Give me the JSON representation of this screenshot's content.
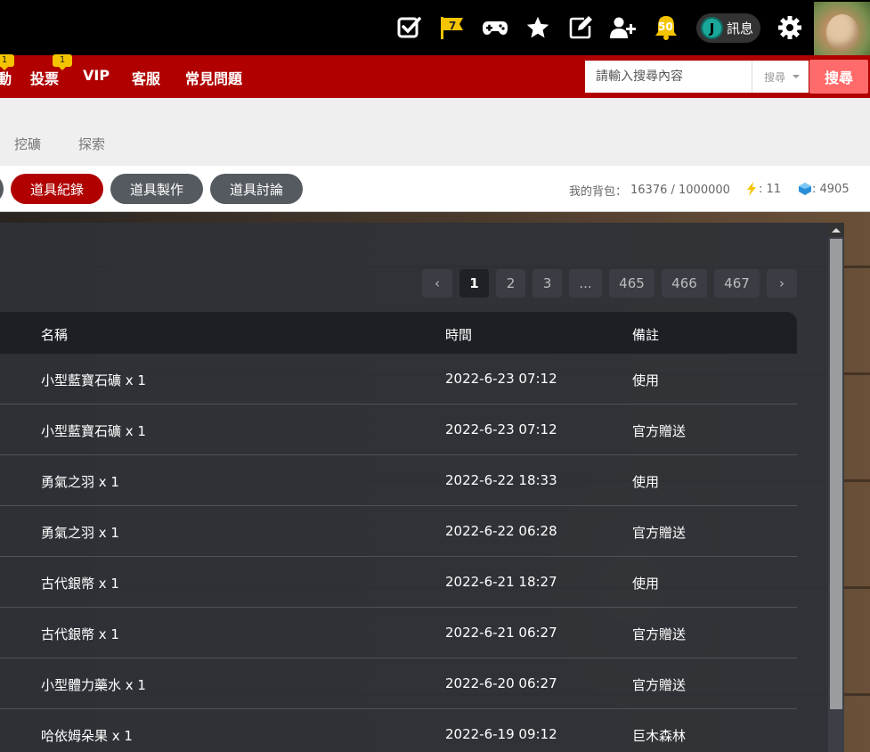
{
  "topbar": {
    "flag_count": "7",
    "bell_count": "50",
    "message_label": "訊息",
    "icons": [
      "checkbox-icon",
      "flag-icon",
      "gamepad-icon",
      "star-icon",
      "edit-icon",
      "add-user-icon",
      "bell-icon",
      "gear-icon"
    ]
  },
  "nav": {
    "items": [
      {
        "label": "動",
        "badge": "1"
      },
      {
        "label": "投票",
        "badge": "1"
      },
      {
        "label": "VIP"
      },
      {
        "label": "客服"
      },
      {
        "label": "常見問題"
      }
    ]
  },
  "search": {
    "placeholder": "請輸入搜尋內容",
    "select_value": "搜尋",
    "button_label": "搜尋"
  },
  "subnav": {
    "items": [
      "挖礦",
      "探索"
    ]
  },
  "tabs": {
    "items": [
      {
        "label": "道具紀錄",
        "active": true
      },
      {
        "label": "道具製作",
        "active": false
      },
      {
        "label": "道具討論",
        "active": false
      }
    ]
  },
  "bag": {
    "label": "我的背包：",
    "value": "16376 / 1000000",
    "energy": ": 11",
    "gem": ": 4905"
  },
  "pagination": {
    "prev": "‹",
    "pages": [
      "1",
      "2",
      "3",
      "...",
      "465",
      "466",
      "467"
    ],
    "current": "1",
    "next": "›"
  },
  "table": {
    "headers": {
      "name": "名稱",
      "time": "時間",
      "note": "備註"
    },
    "rows": [
      {
        "name": "小型藍寶石礦 x 1",
        "time": "2022-6-23 07:12",
        "note": "使用"
      },
      {
        "name": "小型藍寶石礦 x 1",
        "time": "2022-6-23 07:12",
        "note": "官方贈送"
      },
      {
        "name": "勇氣之羽 x 1",
        "time": "2022-6-22 18:33",
        "note": "使用"
      },
      {
        "name": "勇氣之羽 x 1",
        "time": "2022-6-22 06:28",
        "note": "官方贈送"
      },
      {
        "name": "古代銀幣 x 1",
        "time": "2022-6-21 18:27",
        "note": "使用"
      },
      {
        "name": "古代銀幣 x 1",
        "time": "2022-6-21 06:27",
        "note": "官方贈送"
      },
      {
        "name": "小型體力藥水 x 1",
        "time": "2022-6-20 06:27",
        "note": "官方贈送"
      },
      {
        "name": "哈依姆朵果 x 1",
        "time": "2022-6-19 09:12",
        "note": "巨木森林"
      }
    ]
  },
  "colors": {
    "brand_red": "#b00000",
    "search_button": "#ff6b6b",
    "badge_yellow": "#f5c400",
    "panel": "#2e3138"
  }
}
